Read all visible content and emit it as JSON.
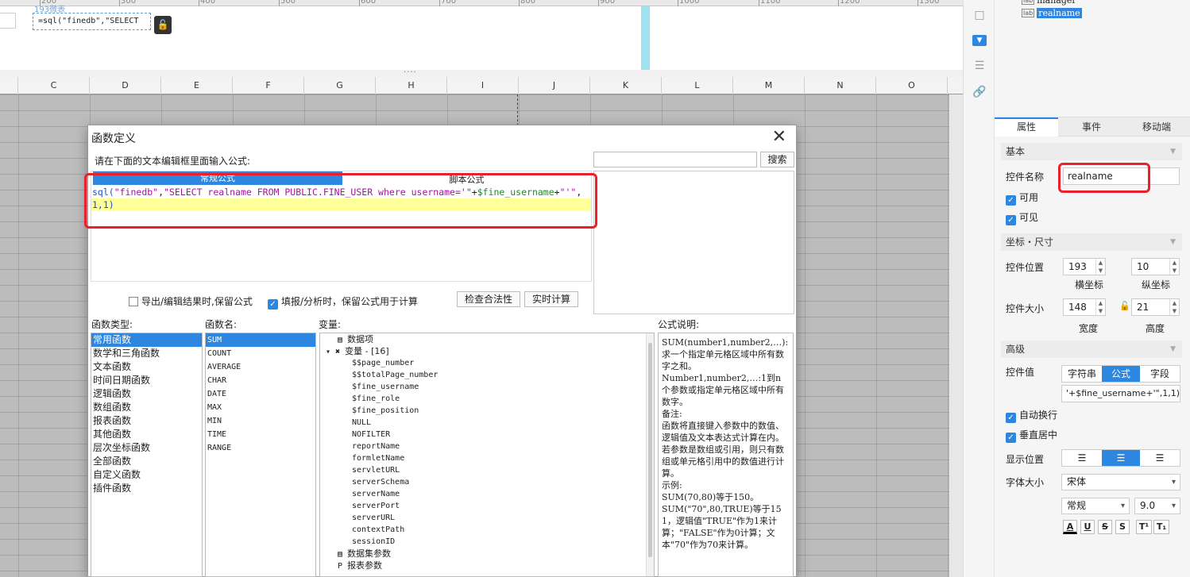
{
  "ruler": {
    "ticks": [
      "200",
      "300",
      "400",
      "500",
      "600",
      "700",
      "800",
      "900",
      "1000",
      "1100",
      "1200",
      "1300"
    ]
  },
  "canvas": {
    "widget_badge": "193微表",
    "formula_widget_text": "=sql(\"finedb\",\"SELECT",
    "lock_icon": "lock-icon"
  },
  "sheet": {
    "columns": [
      "C",
      "D",
      "E",
      "F",
      "G",
      "H",
      "I",
      "J",
      "K",
      "L",
      "M",
      "N",
      "O"
    ]
  },
  "dialog": {
    "title": "函数定义",
    "close": "✕",
    "prompt": "请在下面的文本编辑框里面输入公式:",
    "search_button": "搜索",
    "tabs": {
      "common": "常规公式",
      "script": "脚本公式"
    },
    "code": {
      "line1_fn": "sql(",
      "line1_str1": "\"finedb\"",
      "line1_comma1": ",",
      "line1_str2": "\"SELECT realname FROM PUBLIC.FINE_USER where username='\"",
      "line1_plus1": "+",
      "line1_var": "$fine_username",
      "line1_plus2": "+",
      "line1_str3": "\"'\"",
      "line1_comma2": ",",
      "line2": "1,1)"
    },
    "options": {
      "export_keep": "导出/编辑结果时,保留公式",
      "fill_keep": "填报/分析时，保留公式用于计算"
    },
    "buttons": {
      "check": "检查合法性",
      "calc": "实时计算"
    },
    "func_type_title": "函数类型:",
    "func_name_title": "函数名:",
    "variable_title": "变量:",
    "explain_title": "公式说明:",
    "func_types": [
      "常用函数",
      "数学和三角函数",
      "文本函数",
      "时间日期函数",
      "逻辑函数",
      "数组函数",
      "报表函数",
      "其他函数",
      "层次坐标函数",
      "全部函数",
      "自定义函数",
      "插件函数"
    ],
    "func_names": [
      "SUM",
      "COUNT",
      "AVERAGE",
      "CHAR",
      "DATE",
      "MAX",
      "MIN",
      "TIME",
      "RANGE"
    ],
    "variables": {
      "data_item": "数据项",
      "var_group": "变量 - [16]",
      "items": [
        "$$page_number",
        "$$totalPage_number",
        "$fine_username",
        "$fine_role",
        "$fine_position",
        "NULL",
        "NOFILTER",
        "reportName",
        "formletName",
        "servletURL",
        "serverSchema",
        "serverName",
        "serverPort",
        "serverURL",
        "contextPath",
        "sessionID"
      ],
      "dataset_params": "数据集参数",
      "report_params": "报表参数"
    },
    "explain_lines": [
      "SUM(number1,number2,…):求一个指定单元格区域中所有数字之和。",
      "Number1,number2,…:1到n个参数或指定单元格区域中所有数字。",
      "备注:",
      "函数将直接键入参数中的数值、逻辑值及文本表达式计算在内。若参数是数组或引用，则只有数组或单元格引用中的数值进行计算。",
      "示例:",
      "SUM(70,80)等于150。",
      "SUM(\"70\",80,TRUE)等于151，逻辑值\"TRUE\"作为1来计算；\"FALSE\"作为0计算；文本\"70\"作为70来计算。"
    ]
  },
  "tree": {
    "item1": "manager",
    "item2": "realname"
  },
  "panel": {
    "tabs": [
      "属性",
      "事件",
      "移动端"
    ],
    "section_basic": "基本",
    "name_label": "控件名称",
    "name_value": "realname",
    "enabled": "可用",
    "visible": "可见",
    "section_pos": "坐标・尺寸",
    "pos_label": "控件位置",
    "pos_x": "193",
    "pos_y": "10",
    "x_label": "横坐标",
    "y_label": "纵坐标",
    "size_label": "控件大小",
    "size_w": "148",
    "size_h": "21",
    "w_label": "宽度",
    "h_label": "高度",
    "section_adv": "高级",
    "value_label": "控件值",
    "value_modes": [
      "字符串",
      "公式",
      "字段"
    ],
    "value_text": "'+$fine_username+'\",1,1)",
    "auto_wrap": "自动换行",
    "v_center": "垂直居中",
    "display_label": "显示位置",
    "font_label": "字体大小",
    "font_family": "宋体",
    "font_style": "常规",
    "font_size": "9.0",
    "format_buttons": [
      "A",
      "U",
      "S",
      "S",
      "T¹",
      "T₁"
    ]
  }
}
